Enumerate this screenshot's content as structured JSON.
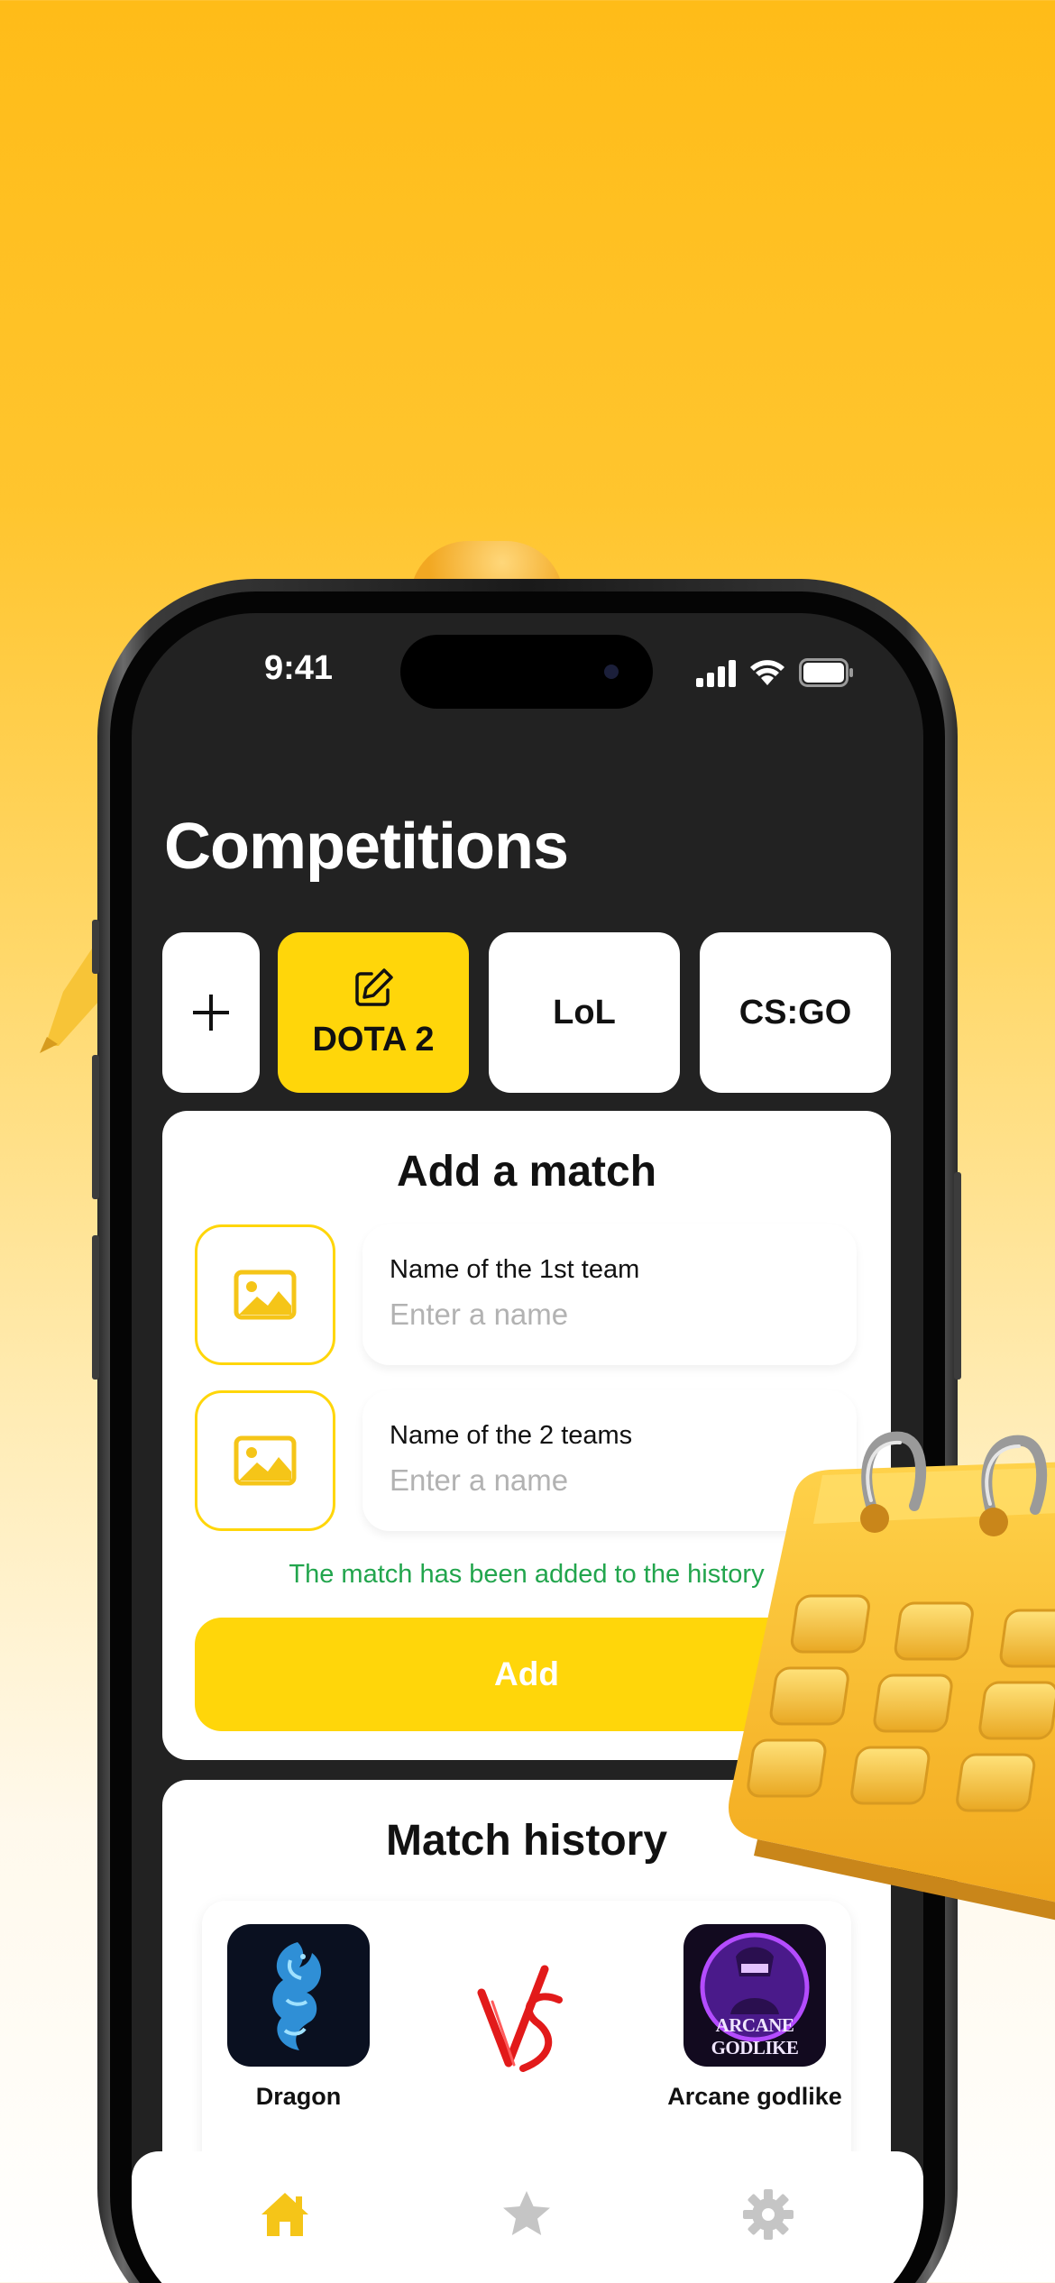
{
  "status_bar": {
    "time": "9:41",
    "icons": [
      "cellular-icon",
      "wifi-icon",
      "battery-icon"
    ]
  },
  "page": {
    "title": "Competitions"
  },
  "tabs": [
    {
      "label": "+",
      "icon": "plus-icon",
      "active": false
    },
    {
      "label": "DOTA 2",
      "icon": "edit-icon",
      "active": true
    },
    {
      "label": "LoL",
      "active": false
    },
    {
      "label": "CS:GO",
      "active": false
    }
  ],
  "add_match": {
    "title": "Add a match",
    "team1": {
      "label": "Name of the 1st team",
      "value": "",
      "placeholder": "Enter a name",
      "image_icon": "image-icon"
    },
    "team2": {
      "label": "Name of the 2 teams",
      "value": "",
      "placeholder": "Enter a name",
      "image_icon": "image-icon"
    },
    "success_message": "The match has been added to the history",
    "add_label": "Add"
  },
  "match_history": {
    "title": "Match history",
    "matches": [
      {
        "team1": {
          "name": "Dragon",
          "logo": "dragon-logo"
        },
        "versus": "VS",
        "team2": {
          "name": "Arcane godlike",
          "logo": "arcane-godlike-logo",
          "logo_text": "ARCANE GODLIKE"
        }
      }
    ]
  },
  "bottom_nav": [
    {
      "icon": "home-icon",
      "active": true
    },
    {
      "icon": "star-icon",
      "active": false
    },
    {
      "icon": "gear-icon",
      "active": false
    }
  ],
  "colors": {
    "accent": "#FFD60A",
    "screen_background": "#222222",
    "success": "#22A54D",
    "inactive_icon": "#C5C5C5",
    "versus": "#E21A1A"
  }
}
